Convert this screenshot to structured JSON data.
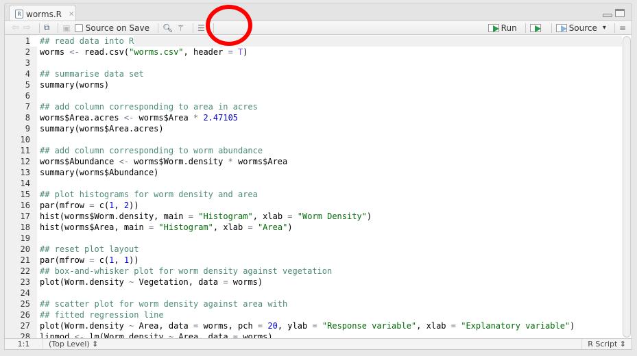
{
  "tab": {
    "title": "worms.R",
    "close": "×"
  },
  "toolbar": {
    "source_on_save": "Source on Save",
    "run": "Run",
    "source": "Source",
    "source_dropdown": "▾"
  },
  "editor": {
    "lines": [
      "## read data into R",
      "worms <- read.csv(\"worms.csv\", header = T)",
      "",
      "## summarise data set",
      "summary(worms)",
      "",
      "## add column corresponding to area in acres",
      "worms$Area.acres <- worms$Area * 2.47105",
      "summary(worms$Area.acres)",
      "",
      "## add column corresponding to worm abundance",
      "worms$Abundance <- worms$Worm.density * worms$Area",
      "summary(worms$Abundance)",
      "",
      "## plot histograms for worm density and area",
      "par(mfrow = c(1, 2))",
      "hist(worms$Worm.density, main = \"Histogram\", xlab = \"Worm Density\")",
      "hist(worms$Area, main = \"Histogram\", xlab = \"Area\")",
      "",
      "## reset plot layout",
      "par(mfrow = c(1, 1))",
      "## box-and-whisker plot for worm density against vegetation",
      "plot(Worm.density ~ Vegetation, data = worms)",
      "",
      "## scatter plot for worm density against area with",
      "## fitted regression line",
      "plot(Worm.density ~ Area, data = worms, pch = 20, ylab = \"Response variable\", xlab = \"Explanatory variable\")",
      "linmod <- lm(Worm.density ~ Area, data = worms)"
    ]
  },
  "status": {
    "position": "1:1",
    "scope": "(Top Level) ⇕",
    "file_type": "R Script ⇕"
  },
  "annotation_color": "#ff0000"
}
